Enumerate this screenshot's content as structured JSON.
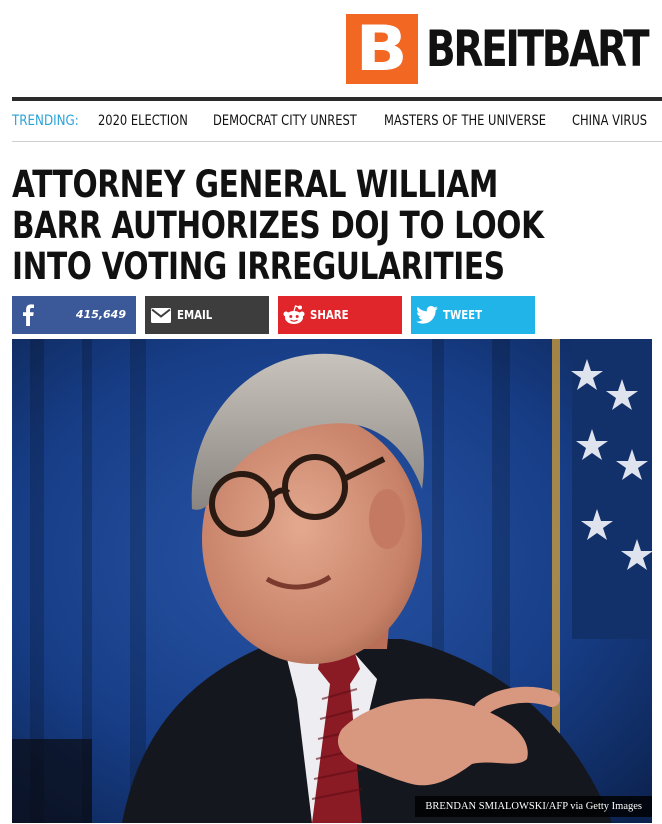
{
  "site": {
    "logo_letter": "B",
    "name": "BREITBART",
    "brand_color": "#f26722"
  },
  "trending": {
    "label": "TRENDING:",
    "items": [
      {
        "label": "2020 ELECTION"
      },
      {
        "label": "DEMOCRAT CITY UNREST"
      },
      {
        "label": "MASTERS OF THE UNIVERSE"
      },
      {
        "label": "CHINA VIRUS"
      }
    ]
  },
  "article": {
    "headline": "ATTORNEY GENERAL WILLIAM BARR AUTHORIZES DOJ TO LOOK INTO VOTING IRREGULARITIES",
    "photo_credit": "BRENDAN SMIALOWSKI/AFP via Getty Images"
  },
  "share": {
    "facebook": {
      "count": "415,649",
      "icon": "facebook-icon",
      "color": "#3b5998"
    },
    "email": {
      "label": "EMAIL",
      "icon": "envelope-icon",
      "color": "#3d3d3d"
    },
    "reddit": {
      "label": "SHARE",
      "icon": "reddit-icon",
      "color": "#e0262a"
    },
    "twitter": {
      "label": "TWEET",
      "icon": "twitter-icon",
      "color": "#21b4e8"
    }
  }
}
